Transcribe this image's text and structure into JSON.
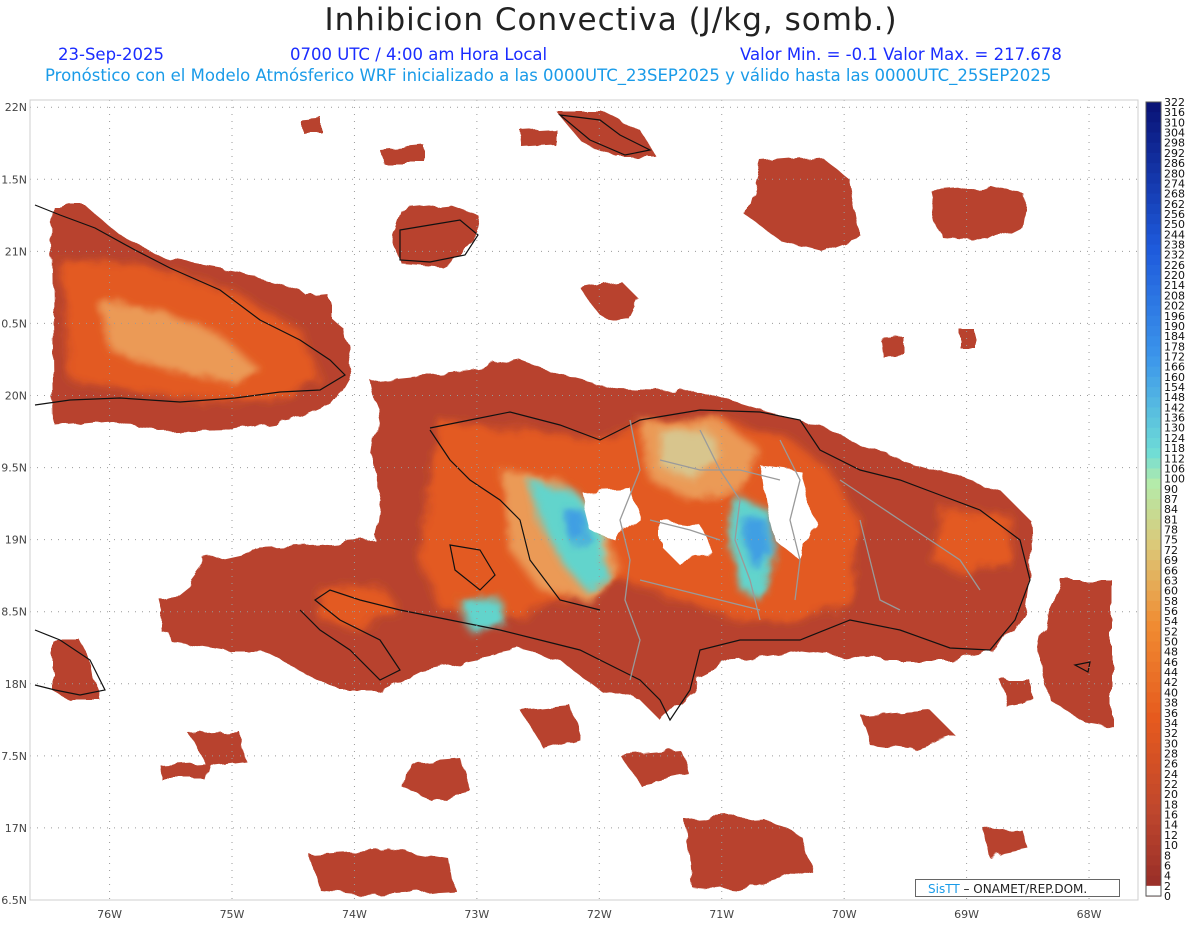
{
  "header": {
    "title": "Inhibicion Convectiva (J/kg, somb.)",
    "date": "23-Sep-2025",
    "time": "0700 UTC / 4:00 am Hora Local",
    "minmax": "Valor Min. = -0.1  Valor Max. = 217.678",
    "subtitle": "Pronóstico con el Modelo Atmósferico WRF inicializado a las 0000UTC_23SEP2025 y válido hasta las  0000UTC_25SEP2025"
  },
  "credit": {
    "sis": "SisTT",
    "rest": " – ONAMET/REP.DOM."
  },
  "chart_data": {
    "type": "heatmap",
    "title": "Inhibicion Convectiva (J/kg, somb.)",
    "xlabel": "",
    "ylabel": "",
    "x_ticks": [
      "76W",
      "75W",
      "74W",
      "73W",
      "72W",
      "71W",
      "70W",
      "69W",
      "68W"
    ],
    "y_ticks": [
      "22N",
      "21.5N",
      "21N",
      "20.5N",
      "20N",
      "19.5N",
      "19N",
      "18.5N",
      "18N",
      "17.5N",
      "17N",
      "16.5N"
    ],
    "y_tick_labels": [
      "22N",
      "1.5N",
      "21N",
      "0.5N",
      "20N",
      "9.5N",
      "19N",
      "8.5N",
      "18N",
      "7.5N",
      "17N",
      "6.5N"
    ],
    "xlim": [
      "76.65W",
      "67.6W"
    ],
    "ylim": [
      "16.5N",
      "22.05N"
    ],
    "grid": true,
    "value_min": -0.1,
    "value_max": 217.678,
    "colorbar_levels": [
      "322",
      "316",
      "310",
      "304",
      "298",
      "292",
      "286",
      "280",
      "274",
      "268",
      "262",
      "256",
      "250",
      "244",
      "238",
      "232",
      "226",
      "220",
      "214",
      "208",
      "202",
      "196",
      "190",
      "184",
      "178",
      "172",
      "166",
      "160",
      "154",
      "148",
      "142",
      "136",
      "130",
      "124",
      "118",
      "112",
      "106",
      "100",
      "90",
      "87",
      "84",
      "81",
      "78",
      "75",
      "72",
      "69",
      "66",
      "63",
      "60",
      "58",
      "56",
      "54",
      "52",
      "50",
      "48",
      "46",
      "44",
      "42",
      "40",
      "38",
      "36",
      "34",
      "32",
      "30",
      "28",
      "26",
      "24",
      "22",
      "20",
      "18",
      "16",
      "14",
      "12",
      "10",
      "8",
      "6",
      "4",
      "2",
      "0"
    ],
    "colors": {
      "low": "#b8412c",
      "mid": "#ef6a1e",
      "warm": "#e8b268",
      "pale": "#d6c98a",
      "cyan": "#5fd6cf",
      "blue": "#2a8fe6",
      "navy": "#0a1a88",
      "coast": "#111111",
      "border": "#9a9a9a"
    }
  }
}
